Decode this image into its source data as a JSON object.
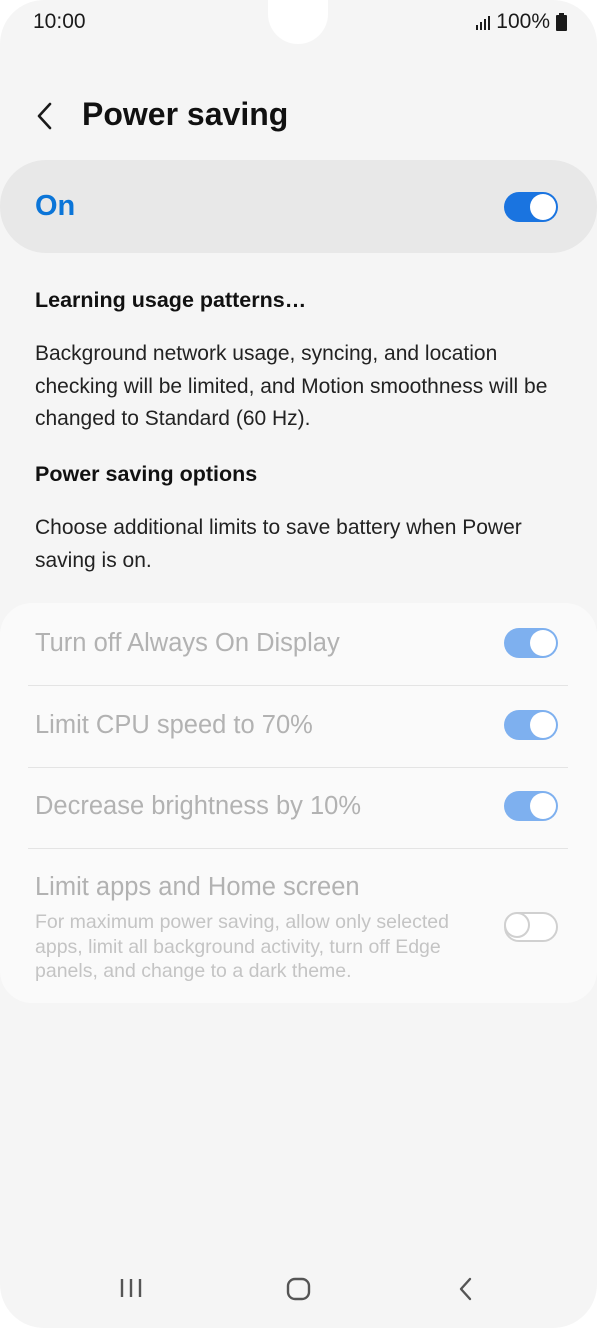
{
  "status": {
    "time": "10:00",
    "battery": "100%"
  },
  "header": {
    "title": "Power saving"
  },
  "master": {
    "label": "On",
    "enabled": true
  },
  "learning": {
    "heading": "Learning usage patterns…",
    "text": "Background network usage, syncing, and location checking will be limited, and Motion smoothness will be changed to Standard (60 Hz)."
  },
  "options": {
    "heading": "Power saving options",
    "text": "Choose additional limits to save battery when Power saving is on.",
    "items": [
      {
        "label": "Turn off Always On Display",
        "enabled": true
      },
      {
        "label": "Limit CPU speed to 70%",
        "enabled": true
      },
      {
        "label": "Decrease brightness by 10%",
        "enabled": true
      },
      {
        "label": "Limit apps and Home screen",
        "subtext": "For maximum power saving, allow only selected apps, limit all background activity, turn off Edge panels, and change to a dark theme.",
        "enabled": false
      }
    ]
  },
  "colors": {
    "accent": "#0b75d8",
    "toggle_on": "#1a74e0",
    "toggle_on_disabled": "#7eb0ef",
    "disabled_text": "#b2b2b2"
  },
  "icons": {
    "back": "chevron-left-icon",
    "signal": "signal-icon",
    "battery": "battery-icon",
    "nav_recents": "recents-icon",
    "nav_home": "home-icon",
    "nav_back": "back-icon"
  }
}
